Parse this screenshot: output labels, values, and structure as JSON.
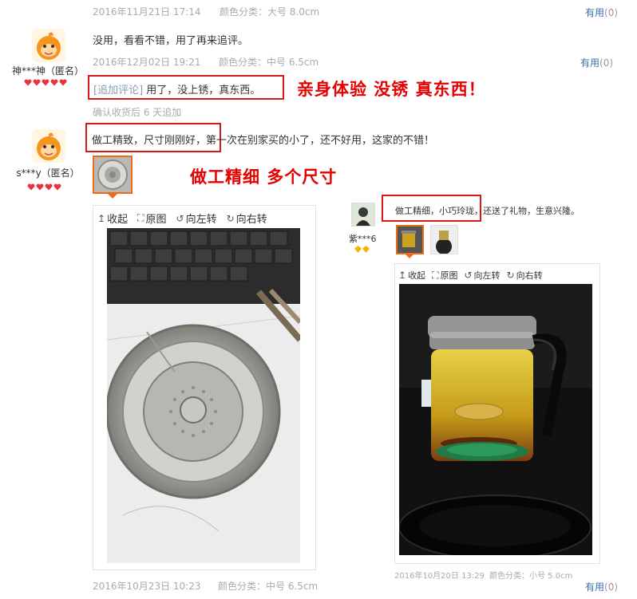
{
  "colors": {
    "accent": "#ee6a16",
    "annotation": "#e60000",
    "link": "#3a6fa8",
    "meta": "#aaaaaa"
  },
  "review0": {
    "date": "2016年11月21日 17:14",
    "sku": "颜色分类：大号 8.0cm",
    "helpful_label": "有用",
    "helpful_count": "(0)"
  },
  "review1": {
    "user": "神***神（匿名）",
    "text": "没用，看看不错，用了再来追评。",
    "date": "2016年12月02日 19:21",
    "sku": "颜色分类：中号 6.5cm",
    "helpful_label": "有用",
    "helpful_count": "(0)",
    "append_tag": "[追加评论]",
    "append_text": "用了，没上锈，真东西。",
    "append_note": "确认收货后 6 天追加",
    "annotation": "亲身体验  没锈  真东西！",
    "level_icon": "heart-icon",
    "hearts": 5
  },
  "review2": {
    "user": "s***y（匿名）",
    "text_boxed": "做工精致，尺寸刚刚好，",
    "text_rest": "第一次在别家买的小了，还不好用，这家的不错！",
    "annotation": "做工精细  多个尺寸",
    "hearts": 4,
    "toolbar": [
      "收起",
      "原图",
      "向左转",
      "向右转"
    ],
    "date": "2016年10月23日 10:23",
    "sku": "颜色分类：中号 6.5cm"
  },
  "review3": {
    "user": "紫***6",
    "text_boxed": "做工精细，小巧玲珑，",
    "text_rest": "还送了礼物，生意兴隆。",
    "toolbar": [
      "收起",
      "原图",
      "向左转",
      "向右转"
    ],
    "date": "2016年10月20日 13:29",
    "sku": "颜色分类：小号 5.0cm",
    "helpful_label": "有用",
    "helpful_count": "(0)",
    "level_icon": "diamond-icon",
    "diamonds": 2
  }
}
